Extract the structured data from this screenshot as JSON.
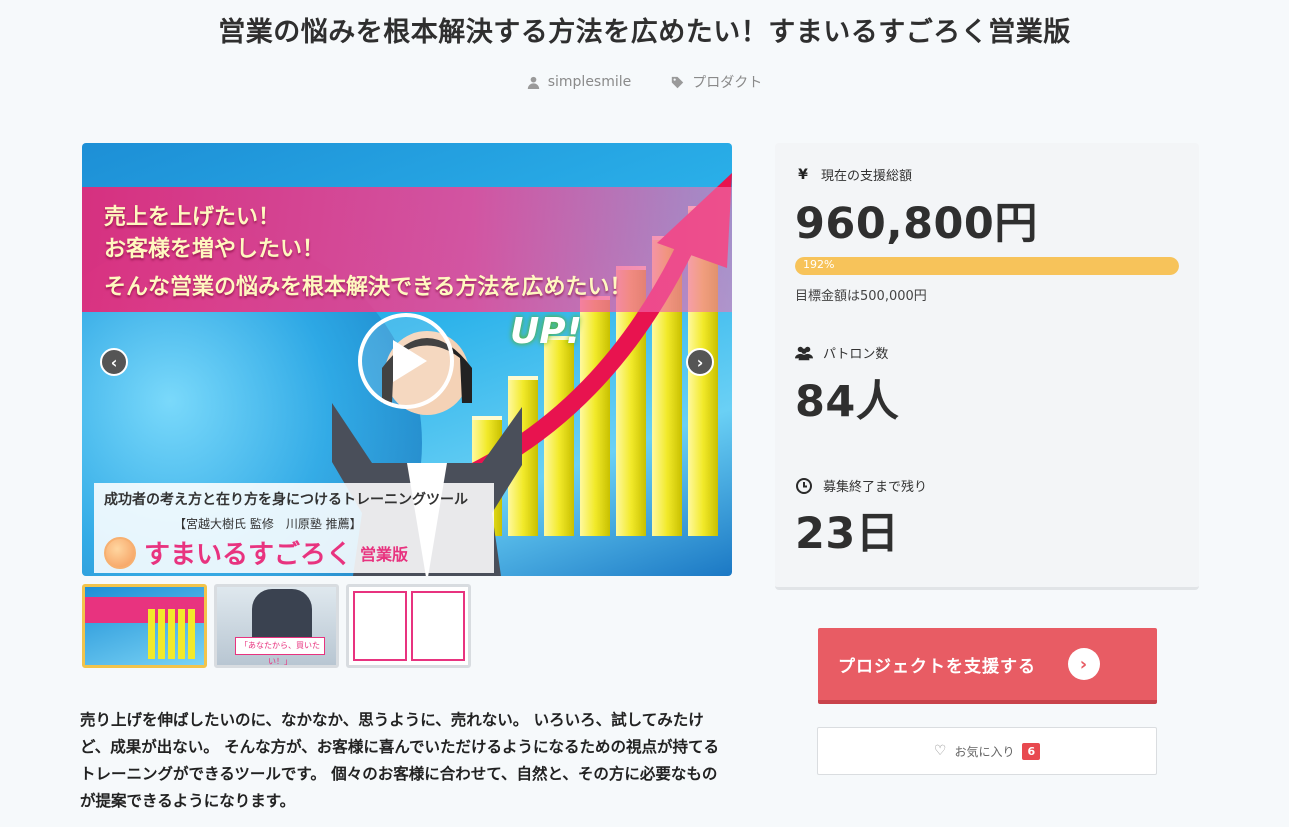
{
  "page": {
    "title": "営業の悩みを根本解決する方法を広めたい！すまいるすごろく営業版"
  },
  "meta": {
    "author": "simplesmile",
    "category": "プロダクト",
    "author_icon": "user-icon",
    "category_icon": "tag-icon"
  },
  "hero": {
    "banner_lines": [
      "売上を上げたい！",
      "お客様を増やしたい！",
      "そんな営業の悩みを根本解決できる方法を広めたい！"
    ],
    "up_text": "UP!",
    "caption_line1": "成功者の考え方と在り方を身につけるトレーニングツール",
    "caption_line2": "【宮越大樹氏 監修　川原塾 推薦】",
    "caption_logo": "すまいるすごろく",
    "caption_logo_suffix": "営業版",
    "prev_icon": "chevron-left-icon",
    "next_icon": "chevron-right-icon",
    "play_icon": "play-icon"
  },
  "thumbnails": {
    "t2_caption": "「あなたから、買いたい！」"
  },
  "description": "売り上げを伸ばしたいのに、なかなか、思うように、売れない。 いろいろ、試してみたけど、成果が出ない。 そんな方が、お客様に喜んでいただけるようになるための視点が持てるトレーニングができるツールです。 個々のお客様に合わせて、自然と、その方に必要なものが提案できるようになります。",
  "stats": {
    "total": {
      "icon": "yen-icon",
      "icon_glyph": "¥",
      "label": "現在の支援総額",
      "value": "960,800円",
      "progress_percent": 192,
      "progress_label": "192%",
      "goal": "目標金額は500,000円"
    },
    "patrons": {
      "icon": "users-icon",
      "label": "パトロン数",
      "value": "84人"
    },
    "remaining": {
      "icon": "clock-icon",
      "label": "募集終了まで残り",
      "value": "23日"
    }
  },
  "actions": {
    "support_label": "プロジェクトを支援する",
    "favorite_label": "お気に入り",
    "favorite_count": "6"
  },
  "colors": {
    "accent": "#e85c64",
    "progress": "#f7c35a",
    "badge": "#e8494f"
  }
}
